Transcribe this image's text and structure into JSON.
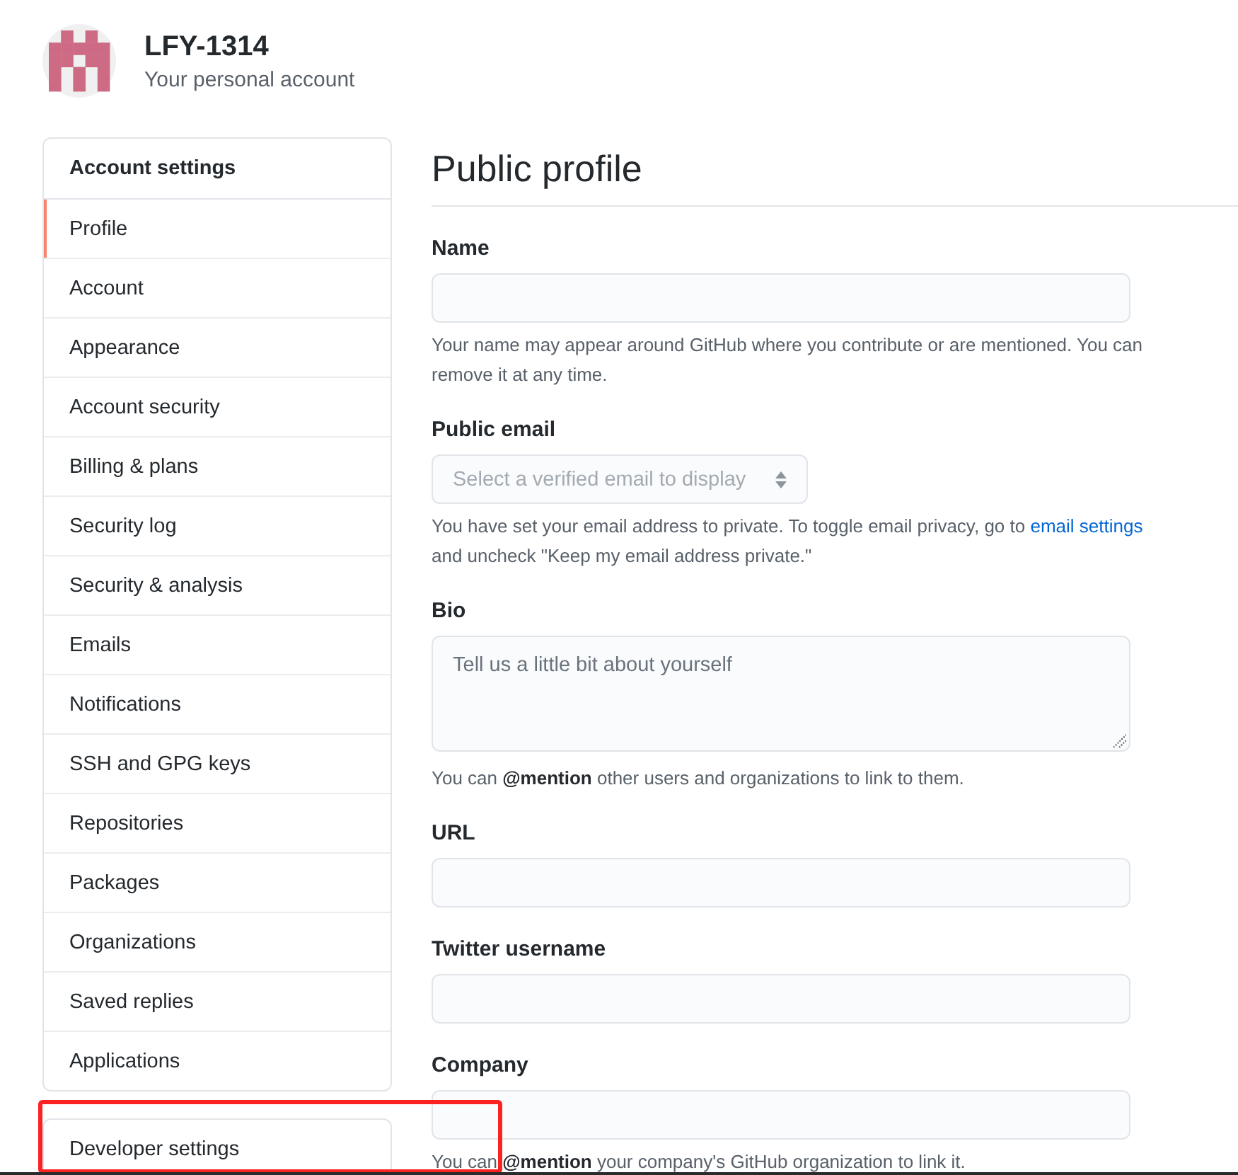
{
  "account": {
    "username": "LFY-1314",
    "subtitle": "Your personal account"
  },
  "sidebar": {
    "title": "Account settings",
    "items": [
      {
        "label": "Profile",
        "selected": true
      },
      {
        "label": "Account",
        "selected": false
      },
      {
        "label": "Appearance",
        "selected": false
      },
      {
        "label": "Account security",
        "selected": false
      },
      {
        "label": "Billing & plans",
        "selected": false
      },
      {
        "label": "Security log",
        "selected": false
      },
      {
        "label": "Security & analysis",
        "selected": false
      },
      {
        "label": "Emails",
        "selected": false
      },
      {
        "label": "Notifications",
        "selected": false
      },
      {
        "label": "SSH and GPG keys",
        "selected": false
      },
      {
        "label": "Repositories",
        "selected": false
      },
      {
        "label": "Packages",
        "selected": false
      },
      {
        "label": "Organizations",
        "selected": false
      },
      {
        "label": "Saved replies",
        "selected": false
      },
      {
        "label": "Applications",
        "selected": false
      }
    ]
  },
  "developer_settings": {
    "label": "Developer settings",
    "highlighted": true
  },
  "main": {
    "title": "Public profile",
    "fields": [
      {
        "kind": "text",
        "label": "Name",
        "disabled": false,
        "help": "Your name may appear around GitHub where you contribute or are mentioned. You can remove it at any time."
      },
      {
        "kind": "select",
        "label": "Public email",
        "disabled": true,
        "placeholder": "Select a verified email to display",
        "help": "You have set your email address to private. To toggle email privacy, go to ",
        "help_link": "email settings",
        "help_after": " and uncheck \"Keep my email address private.\""
      },
      {
        "kind": "textarea",
        "label": "Bio",
        "disabled": false,
        "placeholder": "Tell us a little bit about yourself",
        "help": "You can **@mention** other users and organizations to link to them."
      },
      {
        "kind": "text",
        "label": "URL",
        "disabled": false
      },
      {
        "kind": "text",
        "label": "Twitter username",
        "disabled": false
      },
      {
        "kind": "text",
        "label": "Company",
        "disabled": false,
        "help": "You can **@mention** your company's GitHub organization to link it."
      }
    ]
  }
}
